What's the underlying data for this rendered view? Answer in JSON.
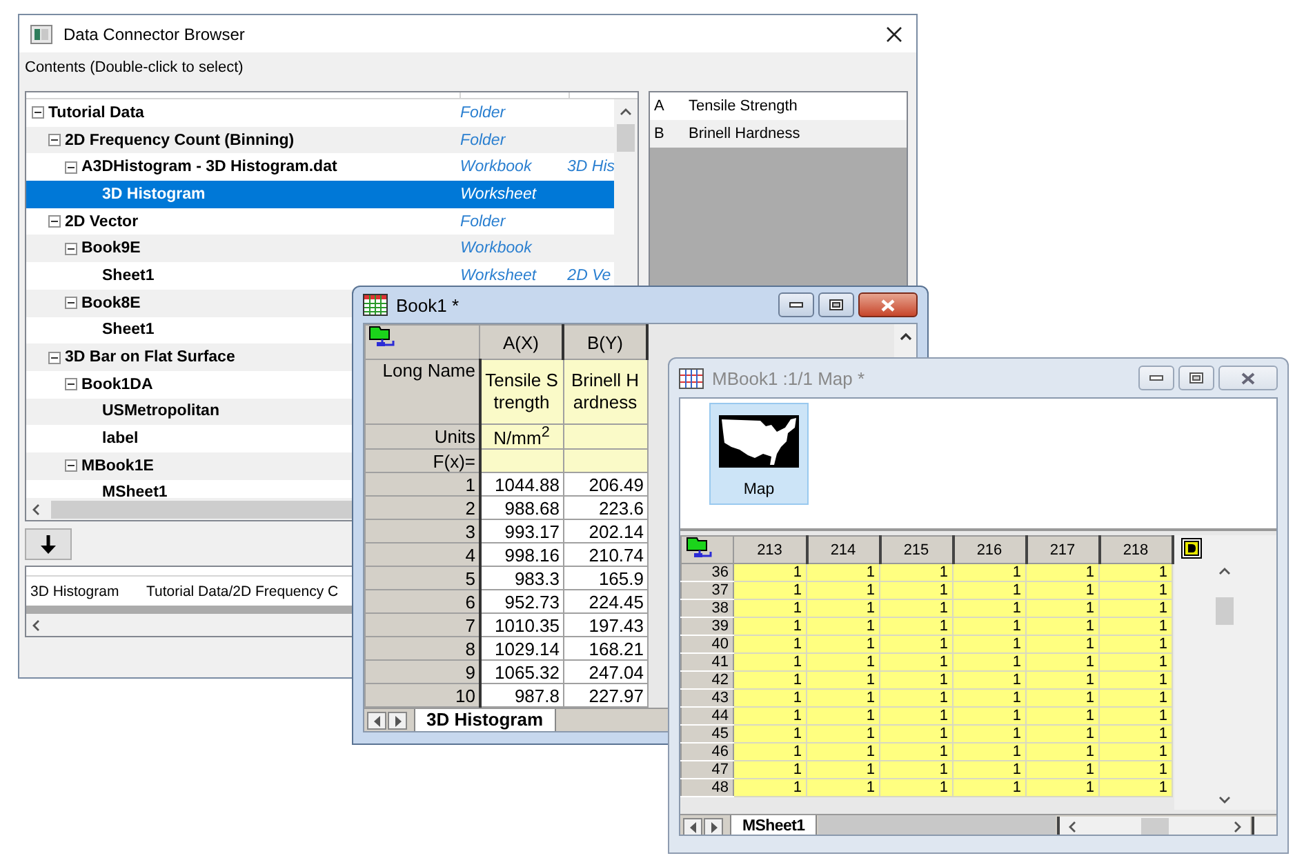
{
  "connector_browser": {
    "title": "Data Connector Browser",
    "contents_label": "Contents (Double-click to select)",
    "tree": [
      {
        "name": "Tutorial Data",
        "type": "Folder",
        "expanded": true,
        "selected": false,
        "children": [
          {
            "name": "2D Frequency Count (Binning)",
            "type": "Folder",
            "expanded": true,
            "selected": false,
            "children": [
              {
                "name": "A3DHistogram - 3D Histogram.dat",
                "type": "Workbook",
                "extra": "3D His",
                "expanded": true,
                "selected": false,
                "children": [
                  {
                    "name": "3D Histogram",
                    "type": "Worksheet",
                    "selected": true
                  }
                ]
              }
            ]
          },
          {
            "name": "2D Vector",
            "type": "Folder",
            "expanded": true,
            "selected": false,
            "children": [
              {
                "name": "Book9E",
                "type": "Workbook",
                "expanded": true,
                "selected": false,
                "children": [
                  {
                    "name": "Sheet1",
                    "type": "Worksheet",
                    "extra": "2D Ve",
                    "selected": false
                  }
                ]
              },
              {
                "name": "Book8E",
                "expanded": true,
                "selected": false,
                "children": [
                  {
                    "name": "Sheet1",
                    "selected": false
                  }
                ]
              }
            ]
          },
          {
            "name": "3D Bar on Flat Surface",
            "expanded": true,
            "selected": false,
            "children": [
              {
                "name": "Book1DA",
                "expanded": true,
                "selected": false,
                "children": [
                  {
                    "name": "USMetropolitan",
                    "selected": false
                  },
                  {
                    "name": "label",
                    "selected": false
                  }
                ]
              },
              {
                "name": "MBook1E",
                "expanded": true,
                "selected": false,
                "children": [
                  {
                    "name": "MSheet1",
                    "selected": false
                  }
                ]
              }
            ]
          }
        ]
      }
    ],
    "columns": [
      {
        "letter": "A",
        "name": "Tensile Strength"
      },
      {
        "letter": "B",
        "name": "Brinell Hardness"
      }
    ],
    "results": [
      {
        "name": "3D Histogram",
        "path": "Tutorial Data/2D Frequency C"
      }
    ]
  },
  "book1": {
    "title": "Book1 *",
    "active": true,
    "row_labels": {
      "long_name": "Long Name",
      "units": "Units",
      "formula": "F(x)="
    },
    "columns": [
      {
        "name": "A(X)",
        "long_name": "Tensile Strength",
        "units": "N/mm$^{2}$"
      },
      {
        "name": "B(Y)",
        "long_name": "Brinell Hardness"
      }
    ],
    "rows": [
      {
        "index": "1",
        "values": [
          "1044.88",
          "206.49"
        ]
      },
      {
        "index": "2",
        "values": [
          "988.68",
          "223.6"
        ]
      },
      {
        "index": "3",
        "values": [
          "993.17",
          "202.14"
        ]
      },
      {
        "index": "4",
        "values": [
          "998.16",
          "210.74"
        ]
      },
      {
        "index": "5",
        "values": [
          "983.3",
          "165.9"
        ]
      },
      {
        "index": "6",
        "values": [
          "952.73",
          "224.45"
        ]
      },
      {
        "index": "7",
        "values": [
          "1010.35",
          "197.43"
        ]
      },
      {
        "index": "8",
        "values": [
          "1029.14",
          "168.21"
        ]
      },
      {
        "index": "9",
        "values": [
          "1065.32",
          "247.04"
        ]
      },
      {
        "index": "10",
        "values": [
          "987.8",
          "227.97"
        ]
      }
    ],
    "tabs": [
      {
        "label": "3D Histogram",
        "selected": true
      }
    ]
  },
  "mbook1": {
    "title": "MBook1 :1/1 Map *",
    "active": false,
    "thumbnails": [
      {
        "label": "Map",
        "selected": true
      }
    ],
    "columns": [
      "213",
      "214",
      "215",
      "216",
      "217",
      "218"
    ],
    "rows": [
      {
        "index": "36",
        "values": [
          "1",
          "1",
          "1",
          "1",
          "1",
          "1"
        ]
      },
      {
        "index": "37",
        "values": [
          "1",
          "1",
          "1",
          "1",
          "1",
          "1"
        ]
      },
      {
        "index": "38",
        "values": [
          "1",
          "1",
          "1",
          "1",
          "1",
          "1"
        ]
      },
      {
        "index": "39",
        "values": [
          "1",
          "1",
          "1",
          "1",
          "1",
          "1"
        ]
      },
      {
        "index": "40",
        "values": [
          "1",
          "1",
          "1",
          "1",
          "1",
          "1"
        ]
      },
      {
        "index": "41",
        "values": [
          "1",
          "1",
          "1",
          "1",
          "1",
          "1"
        ]
      },
      {
        "index": "42",
        "values": [
          "1",
          "1",
          "1",
          "1",
          "1",
          "1"
        ]
      },
      {
        "index": "43",
        "values": [
          "1",
          "1",
          "1",
          "1",
          "1",
          "1"
        ]
      },
      {
        "index": "44",
        "values": [
          "1",
          "1",
          "1",
          "1",
          "1",
          "1"
        ]
      },
      {
        "index": "45",
        "values": [
          "1",
          "1",
          "1",
          "1",
          "1",
          "1"
        ]
      },
      {
        "index": "46",
        "values": [
          "1",
          "1",
          "1",
          "1",
          "1",
          "1"
        ]
      },
      {
        "index": "47",
        "values": [
          "1",
          "1",
          "1",
          "1",
          "1",
          "1"
        ]
      },
      {
        "index": "48",
        "values": [
          "1",
          "1",
          "1",
          "1",
          "1",
          "1"
        ]
      }
    ],
    "tabs": [
      {
        "label": "MSheet1",
        "selected": true
      }
    ]
  }
}
